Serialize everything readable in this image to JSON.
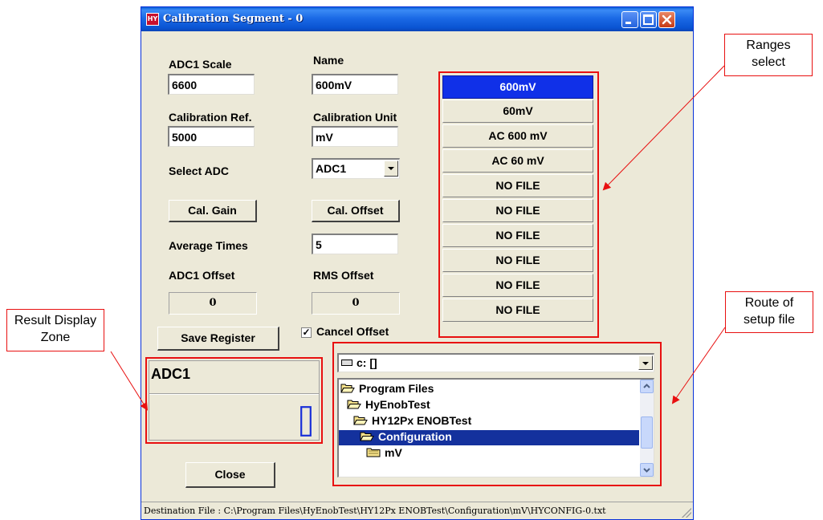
{
  "window": {
    "title": "Calibration Segment - 0",
    "app_icon_text": "HY"
  },
  "form": {
    "adc1_scale_label": "ADC1 Scale",
    "adc1_scale_value": "6600",
    "name_label": "Name",
    "name_value": "600mV",
    "calibration_ref_label": "Calibration Ref.",
    "calibration_ref_value": "5000",
    "calibration_unit_label": "Calibration Unit",
    "calibration_unit_value": "mV",
    "select_adc_label": "Select  ADC",
    "select_adc_value": "ADC1",
    "cal_gain_label": "Cal. Gain",
    "cal_offset_label": "Cal. Offset",
    "average_times_label": "Average Times",
    "average_times_value": "5",
    "adc1_offset_label": "ADC1 Offset",
    "adc1_offset_value": "0",
    "rms_offset_label": "RMS Offset",
    "rms_offset_value": "0",
    "save_register_label": "Save Register",
    "cancel_offset_label": "Cancel Offset",
    "cancel_offset_checked": true,
    "close_label": "Close"
  },
  "ranges": {
    "selected_index": 0,
    "items": [
      "600mV",
      "60mV",
      "AC 600 mV",
      "AC 60 mV",
      "NO FILE",
      "NO FILE",
      "NO FILE",
      "NO FILE",
      "NO FILE",
      "NO FILE"
    ]
  },
  "result_display": {
    "title": "ADC1",
    "value": "0"
  },
  "browser": {
    "drive": "c: []",
    "folders": [
      "Program Files",
      "HyEnobTest",
      "HY12Px ENOBTest",
      "Configuration",
      "mV"
    ],
    "selected_folder": "Configuration"
  },
  "status": {
    "destination": "Destination File : C:\\Program Files\\HyEnobTest\\HY12Px ENOBTest\\Configuration\\mV\\HYCONFIG-0.txt"
  },
  "callouts": {
    "ranges_select": "Ranges select",
    "route_of_setup_file": "Route of setup file",
    "result_display_zone": "Result Display Zone"
  },
  "colors": {
    "accent_red": "#e81010",
    "selected_range": "#1030e8",
    "digit_blue": "#1a2fd8",
    "window_face": "#ece9d8"
  }
}
